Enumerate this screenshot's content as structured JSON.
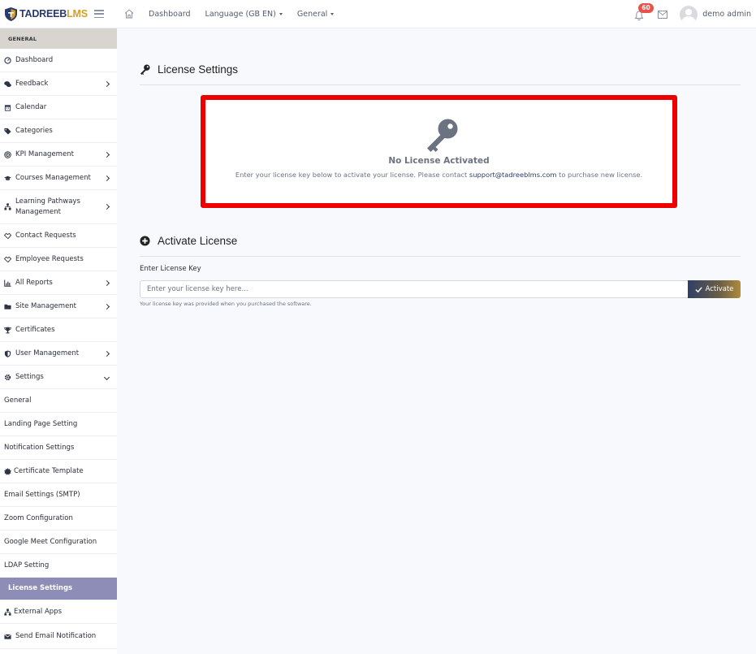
{
  "brand": {
    "part1": "TADREEB",
    "part2": "LMS"
  },
  "topnav": {
    "dashboard": "Dashboard",
    "language": "Language (GB EN)",
    "general": "General",
    "notification_count": "60",
    "user_name": "demo admin"
  },
  "sidebar": {
    "header": "GENERAL",
    "items": [
      {
        "label": "Dashboard",
        "icon": "gauge-icon"
      },
      {
        "label": "Feedback",
        "icon": "comments-icon",
        "chevron": true
      },
      {
        "label": "Calendar",
        "icon": "calendar-icon"
      },
      {
        "label": "Categories",
        "icon": "tags-icon"
      },
      {
        "label": "KPI Management",
        "icon": "bullseye-icon",
        "chevron": true
      },
      {
        "label": "Courses Management",
        "icon": "graduation-cap-icon",
        "chevron": true
      },
      {
        "label": "Learning Pathways Management",
        "icon": "sitemap-icon",
        "chevron": true
      },
      {
        "label": "Contact Requests",
        "icon": "handshake-icon"
      },
      {
        "label": "Employee Requests",
        "icon": "handshake-icon"
      },
      {
        "label": "All Reports",
        "icon": "chart-line-icon",
        "chevron": true
      },
      {
        "label": "Site Management",
        "icon": "folder-icon",
        "chevron": true
      },
      {
        "label": "Certificates",
        "icon": "trophy-icon"
      },
      {
        "label": "User Management",
        "icon": "shield-icon",
        "chevron": true
      },
      {
        "label": "Settings",
        "icon": "gear-icon",
        "chevron": "down"
      }
    ],
    "settings_sub": [
      "General",
      "Landing Page Setting",
      "Notification Settings",
      "Certificate Template",
      "Email Settings (SMTP)",
      "Zoom Configuration",
      "Google Meet Configuration",
      "LDAP Setting",
      "License Settings"
    ],
    "after_items": [
      {
        "label": "External Apps",
        "icon": "sitemap-icon"
      },
      {
        "label": "Send Email Notification",
        "icon": "envelope-icon"
      }
    ]
  },
  "license": {
    "title": "License Settings",
    "status": "No License Activated",
    "desc_before": "Enter your license key below to activate your license. Please contact ",
    "email": "support@tadreeblms.com",
    "desc_after": " to purchase new license."
  },
  "activate": {
    "title": "Activate License",
    "field_label": "Enter License Key",
    "placeholder": "Enter your license key here...",
    "button": "Activate",
    "help": "Your license key was provided when you purchased the software."
  },
  "colors": {
    "highlight_border": "#ee0000",
    "active_sidebar": "#8d8db8",
    "brand_navy": "#2a3a6b",
    "brand_gold": "#d39f2b",
    "badge": "#e5534b"
  }
}
